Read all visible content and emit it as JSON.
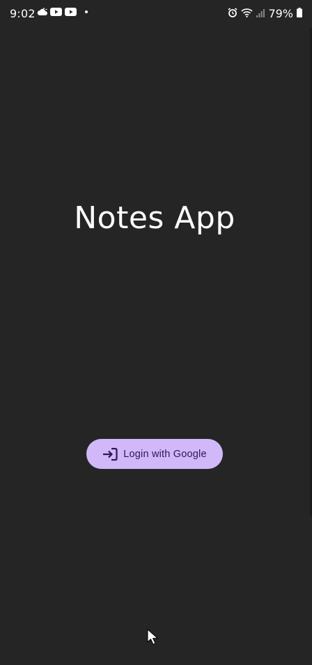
{
  "status_bar": {
    "time": "9:02",
    "battery": "79%",
    "left_icons": [
      "cloud-icon",
      "youtube-icon",
      "youtube-icon"
    ],
    "right_icons": [
      "alarm-icon",
      "wifi-icon",
      "signal-icon",
      "battery-icon"
    ]
  },
  "app": {
    "title": "Notes App"
  },
  "login_button": {
    "icon": "login-icon",
    "label": "Login with Google",
    "background": "#d1b8f9",
    "text_color": "#2a1a52"
  },
  "colors": {
    "background": "#252525",
    "foreground": "#ffffff"
  }
}
